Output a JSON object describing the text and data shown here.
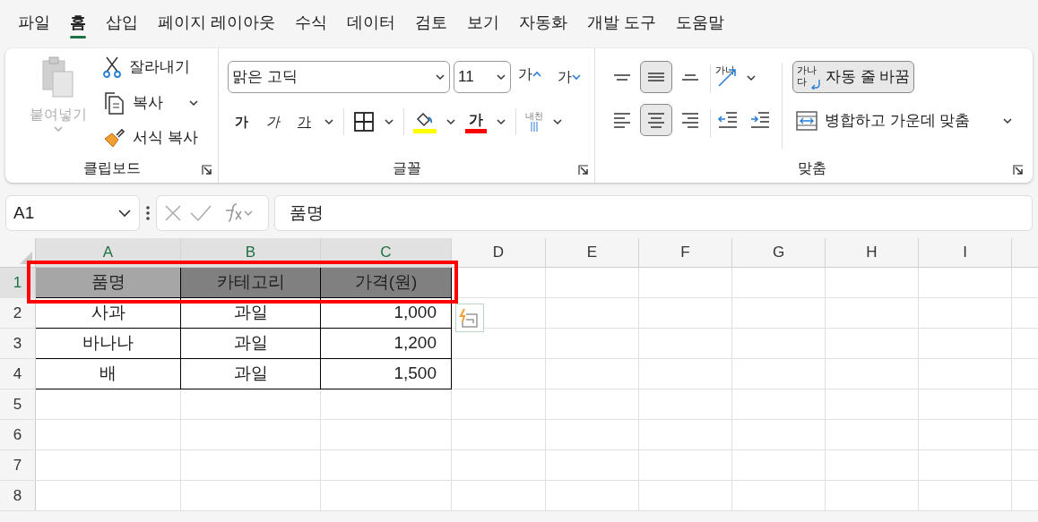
{
  "menu_tabs": [
    {
      "label": "파일",
      "selected": false
    },
    {
      "label": "홈",
      "selected": true
    },
    {
      "label": "삽입",
      "selected": false
    },
    {
      "label": "페이지 레이아웃",
      "selected": false
    },
    {
      "label": "수식",
      "selected": false
    },
    {
      "label": "데이터",
      "selected": false
    },
    {
      "label": "검토",
      "selected": false
    },
    {
      "label": "보기",
      "selected": false
    },
    {
      "label": "자동화",
      "selected": false
    },
    {
      "label": "개발 도구",
      "selected": false
    },
    {
      "label": "도움말",
      "selected": false
    }
  ],
  "clipboard": {
    "label": "클립보드",
    "paste": {
      "label": "붙여넣기",
      "disabled": true
    },
    "cut": "잘라내기",
    "copy": "복사",
    "format_painter": "서식 복사"
  },
  "font": {
    "label": "글꼴",
    "font_name": "맑은 고딕",
    "font_size": "11",
    "grow": "가",
    "shrink": "가",
    "bold": "가",
    "italic": "가",
    "underline": "가",
    "font_color": "가",
    "phonetic": "내천"
  },
  "alignment": {
    "label": "맞춤",
    "vertical": [
      {
        "selected": false
      },
      {
        "selected": true
      },
      {
        "selected": false
      }
    ],
    "horizontal": [
      {
        "selected": false
      },
      {
        "selected": true
      },
      {
        "selected": false
      }
    ],
    "orientation_text": "가나",
    "wrap_icon_text": "가나\n다",
    "wrap_text": {
      "label": "자동 줄 바꿈",
      "selected": true
    },
    "merge": "병합하고 가운데 맞춤"
  },
  "name_box": "A1",
  "formula": "품명",
  "columns": [
    {
      "label": "A",
      "selected": true
    },
    {
      "label": "B",
      "selected": true
    },
    {
      "label": "C",
      "selected": true
    },
    {
      "label": "D",
      "selected": false
    },
    {
      "label": "E",
      "selected": false
    },
    {
      "label": "F",
      "selected": false
    },
    {
      "label": "G",
      "selected": false
    },
    {
      "label": "H",
      "selected": false
    },
    {
      "label": "I",
      "selected": false
    }
  ],
  "rows": [
    {
      "number": "1",
      "selected": true,
      "cells": [
        {
          "text": "품명",
          "color": "#a6a6a6",
          "kind": "text"
        },
        {
          "text": "카테고리",
          "color": "#808080",
          "kind": "text"
        },
        {
          "text": "가격(원)",
          "color": "#808080",
          "kind": "text"
        }
      ]
    },
    {
      "number": "2",
      "selected": false,
      "cells": [
        {
          "text": "사과",
          "kind": "text"
        },
        {
          "text": "과일",
          "kind": "text"
        },
        {
          "text": "1,000",
          "kind": "number"
        }
      ]
    },
    {
      "number": "3",
      "selected": false,
      "cells": [
        {
          "text": "바나나",
          "kind": "text"
        },
        {
          "text": "과일",
          "kind": "text"
        },
        {
          "text": "1,200",
          "kind": "number"
        }
      ]
    },
    {
      "number": "4",
      "selected": false,
      "cells": [
        {
          "text": "배",
          "kind": "text"
        },
        {
          "text": "과일",
          "kind": "text"
        },
        {
          "text": "1,500",
          "kind": "number"
        }
      ]
    },
    {
      "number": "5",
      "selected": false,
      "cells": []
    },
    {
      "number": "6",
      "selected": false,
      "cells": []
    },
    {
      "number": "7",
      "selected": false,
      "cells": []
    },
    {
      "number": "8",
      "selected": false,
      "cells": []
    }
  ]
}
